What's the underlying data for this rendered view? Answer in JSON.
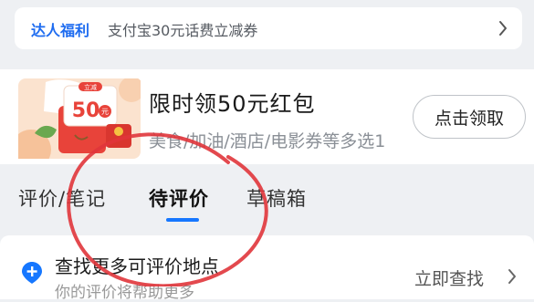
{
  "banner": {
    "tag": "达人福利",
    "text": "支付宝30元话费立减券",
    "icon": "chevron-right-icon"
  },
  "promo": {
    "badge_top": "立减",
    "badge_amount": "50",
    "badge_unit": "元",
    "title": "限时领50元红包",
    "subtitle": "美食/加油/酒店/电影券等多选1",
    "button": "点击领取"
  },
  "tabs": {
    "items": [
      {
        "label": "评价/笔记",
        "active": false
      },
      {
        "label": "待评价",
        "active": true
      },
      {
        "label": "草稿箱",
        "active": false
      }
    ],
    "indicator_color": "#1677ff"
  },
  "find": {
    "icon": "location-plus-icon",
    "title": "查找更多可评价地点",
    "desc": "你的评价将帮助更多",
    "action": "立即查找",
    "action_icon": "chevron-right-icon"
  },
  "colors": {
    "accent": "#1677ff",
    "brand_tag": "#1e6cf0",
    "annotation": "#e0353b"
  }
}
